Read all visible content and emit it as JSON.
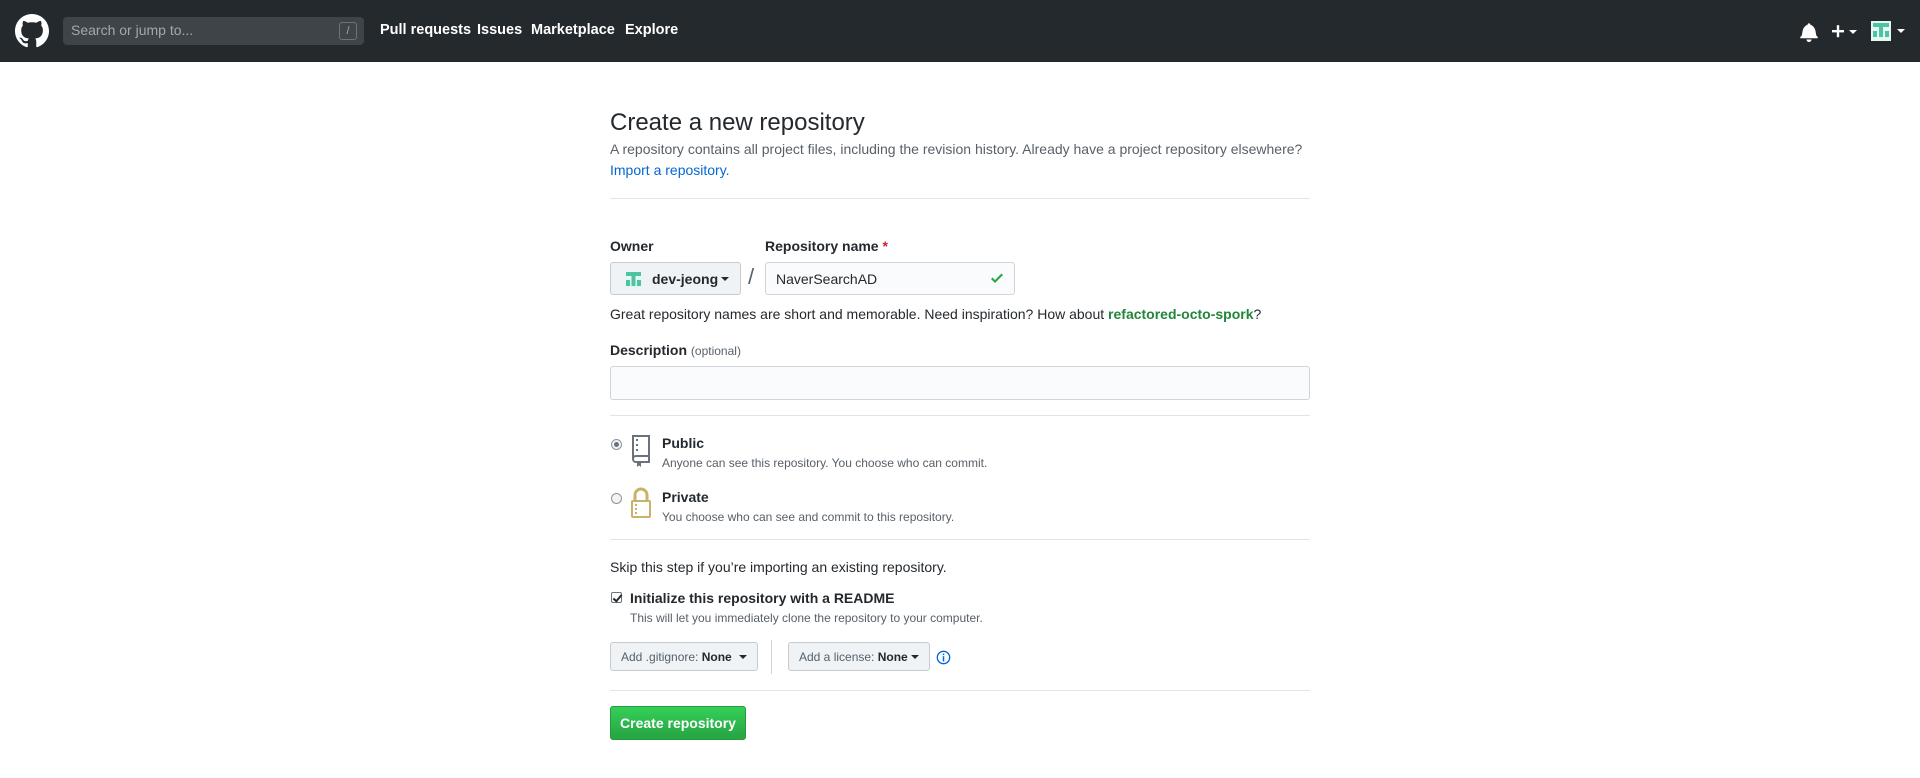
{
  "header": {
    "search_placeholder": "Search or jump to...",
    "search_shortcut": "/",
    "nav": [
      "Pull requests",
      "Issues",
      "Marketplace",
      "Explore"
    ]
  },
  "page": {
    "title": "Create a new repository",
    "subtitle": "A repository contains all project files, including the revision history. Already have a project repository elsewhere?",
    "import_link": "Import a repository."
  },
  "form": {
    "owner_label": "Owner",
    "owner_value": "dev-jeong",
    "repo_name_label": "Repository name",
    "required_mark": "*",
    "slash": "/",
    "repo_name_value": "NaverSearchAD",
    "hint_prefix": "Great repository names are short and memorable. Need inspiration? How about ",
    "hint_suggestion": "refactored-octo-spork",
    "hint_suffix": "?",
    "description_label": "Description",
    "description_optional": "(optional)",
    "description_value": ""
  },
  "visibility": {
    "selected": "public",
    "options": [
      {
        "title": "Public",
        "description": "Anyone can see this repository. You choose who can commit."
      },
      {
        "title": "Private",
        "description": "You choose who can see and commit to this repository."
      }
    ]
  },
  "init": {
    "skip_text": "Skip this step if you’re importing an existing repository.",
    "readme_checked": true,
    "readme_title": "Initialize this repository with a README",
    "readme_desc": "This will let you immediately clone the repository to your computer.",
    "gitignore_label": "Add .gitignore:",
    "gitignore_value": "None",
    "license_label": "Add a license:",
    "license_value": "None"
  },
  "submit": {
    "label": "Create repository"
  },
  "colors": {
    "header_bg": "#24292e",
    "primary_green": "#28a745",
    "link_blue": "#0366d6",
    "suggestion_green": "#22863a",
    "avatar_teal": "#4cc4a4"
  },
  "icons": [
    "github-logo-icon",
    "bell-icon",
    "plus-icon",
    "avatar",
    "check-icon",
    "repo-icon",
    "lock-icon",
    "info-icon"
  ]
}
